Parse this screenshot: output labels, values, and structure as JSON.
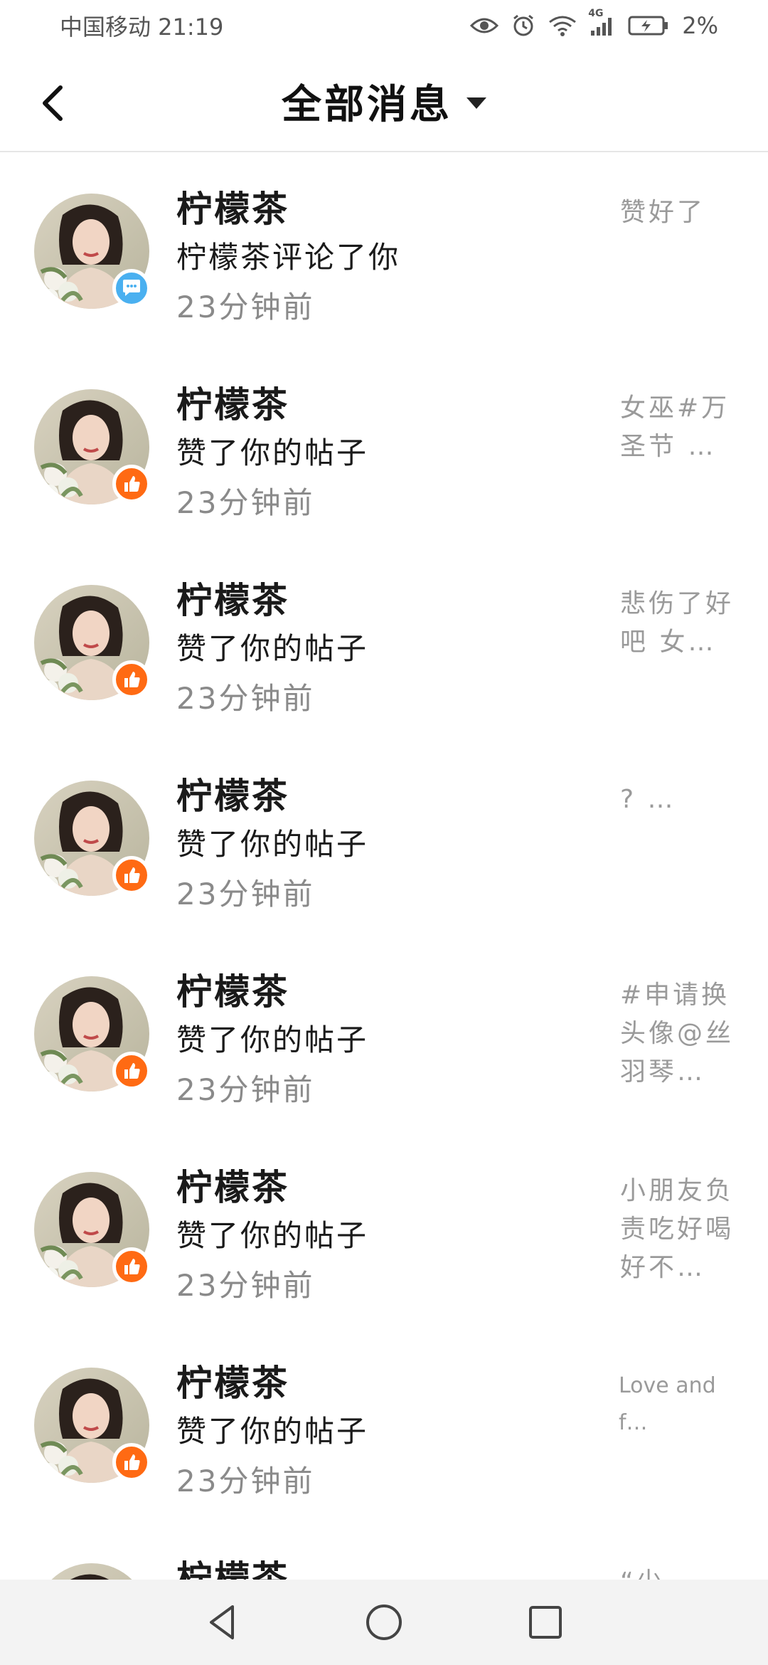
{
  "status_bar": {
    "carrier_time": "中国移动 21:19",
    "network": "4G",
    "battery": "2%"
  },
  "header": {
    "title": "全部消息"
  },
  "messages": [
    {
      "name": "柠檬茶",
      "action": "柠檬茶评论了你",
      "time": "23分钟前",
      "preview": "赞好了",
      "badge": "comment-icon"
    },
    {
      "name": "柠檬茶",
      "action": "赞了你的帖子",
      "time": "23分钟前",
      "preview": "女巫#万\n圣节 …",
      "badge": "thumbs-up-icon"
    },
    {
      "name": "柠檬茶",
      "action": "赞了你的帖子",
      "time": "23分钟前",
      "preview": "悲伤了好\n吧 女…",
      "badge": "thumbs-up-icon"
    },
    {
      "name": "柠檬茶",
      "action": "赞了你的帖子",
      "time": "23分钟前",
      "preview": "? …",
      "badge": "thumbs-up-icon"
    },
    {
      "name": "柠檬茶",
      "action": "赞了你的帖子",
      "time": "23分钟前",
      "preview": "#申请换\n头像@丝\n羽琴…",
      "badge": "thumbs-up-icon"
    },
    {
      "name": "柠檬茶",
      "action": "赞了你的帖子",
      "time": "23分钟前",
      "preview": "小朋友负\n责吃好喝\n好不…",
      "badge": "thumbs-up-icon"
    },
    {
      "name": "柠檬茶",
      "action": "赞了你的帖子",
      "time": "23分钟前",
      "preview": "Love and\nf…",
      "badge": "thumbs-up-icon"
    },
    {
      "name": "柠檬茶",
      "action": "",
      "time": "",
      "preview": "“少",
      "badge": "thumbs-up-icon"
    }
  ],
  "nav": {
    "back": "triangle-back-icon",
    "home": "circle-home-icon",
    "recent": "square-recent-icon"
  },
  "colors": {
    "like_badge": "#ff6a13",
    "comment_badge": "#4ab0f0",
    "muted_text": "#8a8a8a"
  }
}
